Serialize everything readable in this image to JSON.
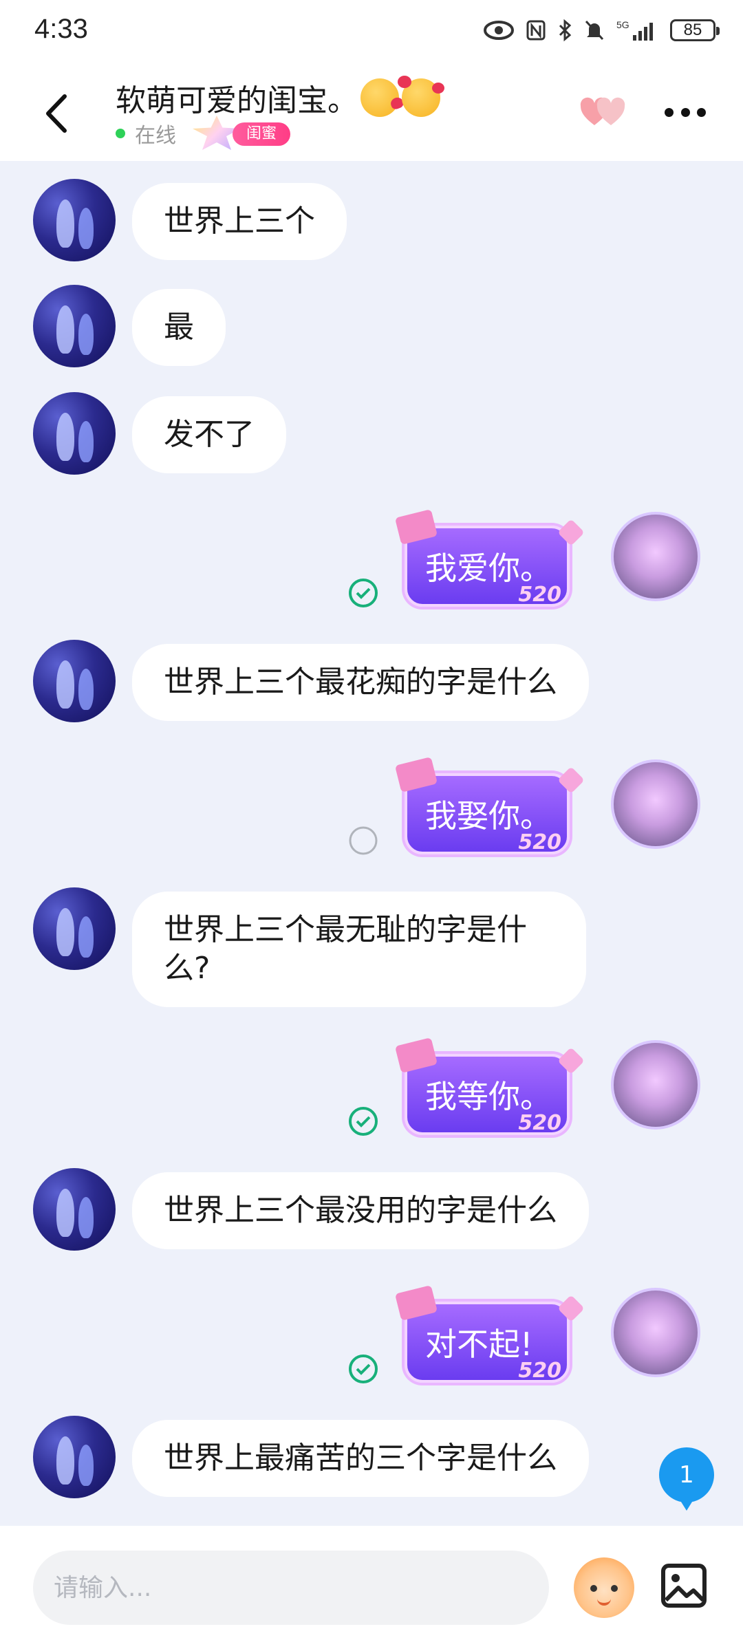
{
  "status_bar": {
    "time": "4:33",
    "battery": "85"
  },
  "header": {
    "title": "软萌可爱的闺宝。",
    "status": "在线",
    "badge": "闺蜜"
  },
  "messages": [
    {
      "side": "left",
      "text": "世界上三个"
    },
    {
      "side": "left",
      "text": "最"
    },
    {
      "side": "left",
      "text": "发不了"
    },
    {
      "side": "right",
      "text": "我爱你。",
      "card_number": "520",
      "status": "delivered"
    },
    {
      "side": "left",
      "text": "世界上三个最花痴的字是什么"
    },
    {
      "side": "right",
      "text": "我娶你。",
      "card_number": "520",
      "status": "sending"
    },
    {
      "side": "left",
      "text": "世界上三个最无耻的字是什么?"
    },
    {
      "side": "right",
      "text": "我等你。",
      "card_number": "520",
      "status": "delivered"
    },
    {
      "side": "left",
      "text": "世界上三个最没用的字是什么"
    },
    {
      "side": "right",
      "text": "对不起!",
      "card_number": "520",
      "status": "delivered"
    },
    {
      "side": "left",
      "text": "世界上最痛苦的三个字是什么"
    }
  ],
  "unread_count": "1",
  "input": {
    "placeholder": "请输入..."
  },
  "colors": {
    "accent": "#1a9af0",
    "chat_bg": "#eef1fa",
    "badge": "#ff3d86",
    "online": "#2ed158",
    "check": "#18b07a"
  }
}
